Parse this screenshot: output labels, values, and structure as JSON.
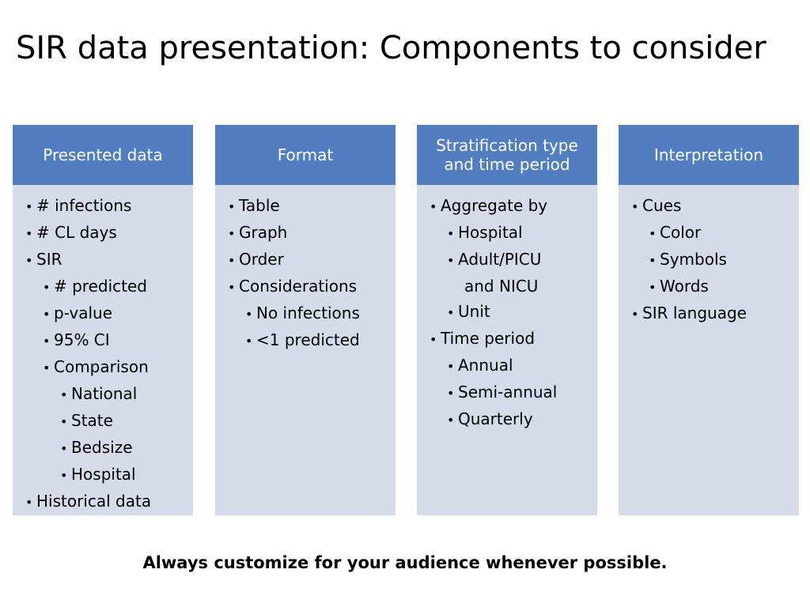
{
  "slide": {
    "title": "SIR data presentation: Components to consider",
    "footer_note": "Always customize for your audience whenever possible.",
    "header_bg": "#517ec0",
    "column_bg": "#d5dbe8",
    "columns": [
      {
        "header": "Presented data",
        "items": [
          {
            "level": 0,
            "bullet": "•",
            "text": "# infections"
          },
          {
            "level": 0,
            "bullet": "•",
            "text": "# CL days"
          },
          {
            "level": 0,
            "bullet": "•",
            "text": "SIR"
          },
          {
            "level": 1,
            "bullet": "•",
            "text": "# predicted"
          },
          {
            "level": 1,
            "bullet": "•",
            "text": "p-value"
          },
          {
            "level": 1,
            "bullet": "•",
            "text": "95% CI"
          },
          {
            "level": 1,
            "bullet": "•",
            "text": "Comparison"
          },
          {
            "level": 2,
            "bullet": "•",
            "text": "National"
          },
          {
            "level": 2,
            "bullet": "•",
            "text": "State"
          },
          {
            "level": 2,
            "bullet": "•",
            "text": "Bedsize"
          },
          {
            "level": 2,
            "bullet": "•",
            "text": "Hospital"
          },
          {
            "level": 0,
            "bullet": "•",
            "text": "Historical data"
          }
        ]
      },
      {
        "header": "Format",
        "items": [
          {
            "level": 0,
            "bullet": "•",
            "text": "Table"
          },
          {
            "level": 0,
            "bullet": "•",
            "text": "Graph"
          },
          {
            "level": 0,
            "bullet": "•",
            "text": "Order"
          },
          {
            "level": 0,
            "bullet": "•",
            "text": "Considerations"
          },
          {
            "level": 1,
            "bullet": "•",
            "text": "No infections"
          },
          {
            "level": 1,
            "bullet": "•",
            "text": "<1 predicted"
          }
        ]
      },
      {
        "header": "Stratification type and time period",
        "items": [
          {
            "level": 0,
            "bullet": "•",
            "text": "Aggregate by"
          },
          {
            "level": 1,
            "bullet": "•",
            "text": "Hospital"
          },
          {
            "level": 1,
            "bullet": "•",
            "text": "Adult/PICU"
          },
          {
            "level": 1,
            "bullet": "",
            "text": "and NICU"
          },
          {
            "level": 1,
            "bullet": "•",
            "text": "Unit"
          },
          {
            "level": 0,
            "bullet": "•",
            "text": "Time period"
          },
          {
            "level": 1,
            "bullet": "•",
            "text": "Annual"
          },
          {
            "level": 1,
            "bullet": "•",
            "text": "Semi-annual"
          },
          {
            "level": 1,
            "bullet": "•",
            "text": "Quarterly"
          }
        ]
      },
      {
        "header": "Interpretation",
        "items": [
          {
            "level": 0,
            "bullet": "•",
            "text": "Cues"
          },
          {
            "level": 1,
            "bullet": "•",
            "text": "Color"
          },
          {
            "level": 1,
            "bullet": "•",
            "text": "Symbols"
          },
          {
            "level": 1,
            "bullet": "•",
            "text": "Words"
          },
          {
            "level": 0,
            "bullet": "•",
            "text": "SIR language"
          }
        ]
      }
    ]
  }
}
